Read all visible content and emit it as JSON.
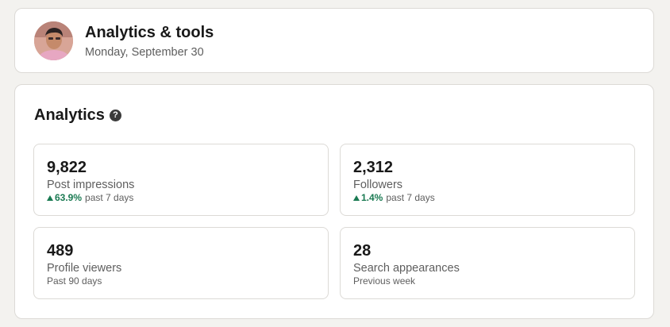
{
  "header": {
    "title": "Analytics & tools",
    "date": "Monday, September 30"
  },
  "analytics": {
    "title": "Analytics",
    "help_icon_glyph": "?",
    "stats": [
      {
        "value": "9,822",
        "label": "Post impressions",
        "change": "63.9%",
        "period": "past 7 days",
        "trend": "up"
      },
      {
        "value": "2,312",
        "label": "Followers",
        "change": "1.4%",
        "period": "past 7 days",
        "trend": "up"
      },
      {
        "value": "489",
        "label": "Profile viewers",
        "period": "Past 90 days"
      },
      {
        "value": "28",
        "label": "Search appearances",
        "period": "Previous week"
      }
    ]
  },
  "colors": {
    "background": "#f3f2ef",
    "card": "#ffffff",
    "border": "#dcdad6",
    "positive_trend": "#1a7a52",
    "text_primary": "#191919",
    "text_secondary": "#5e5e5e"
  }
}
